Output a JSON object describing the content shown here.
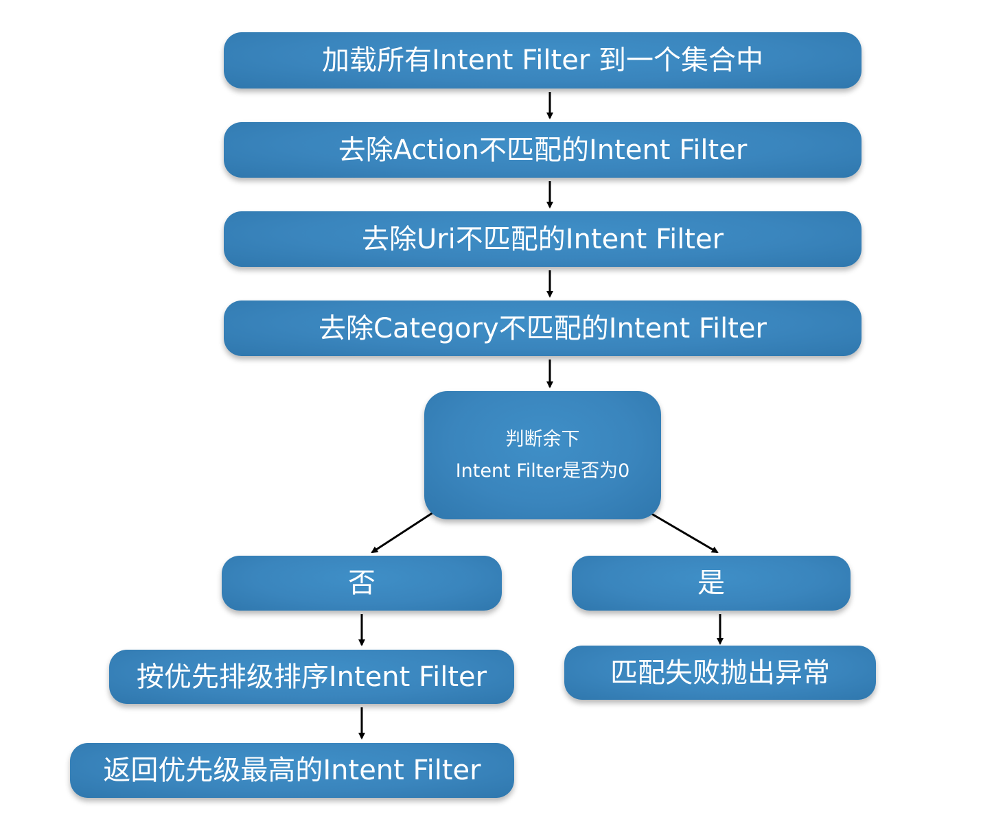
{
  "diagram": {
    "nodes": {
      "load_all": "加载所有Intent Filter 到一个集合中",
      "remove_action": "去除Action不匹配的Intent Filter",
      "remove_uri": "去除Uri不匹配的Intent Filter",
      "remove_category": "去除Category不匹配的Intent Filter",
      "decision_line1": "判断余下",
      "decision_line2": "Intent Filter是否为0",
      "branch_no": "否",
      "branch_yes": "是",
      "sort_priority": "按优先排级排序Intent Filter",
      "match_fail": "匹配失败抛出异常",
      "return_highest": "返回优先级最高的Intent Filter"
    },
    "edges": [
      {
        "from": "load_all",
        "to": "remove_action"
      },
      {
        "from": "remove_action",
        "to": "remove_uri"
      },
      {
        "from": "remove_uri",
        "to": "remove_category"
      },
      {
        "from": "remove_category",
        "to": "decision"
      },
      {
        "from": "decision",
        "to": "branch_no"
      },
      {
        "from": "decision",
        "to": "branch_yes"
      },
      {
        "from": "branch_no",
        "to": "sort_priority"
      },
      {
        "from": "sort_priority",
        "to": "return_highest"
      },
      {
        "from": "branch_yes",
        "to": "match_fail"
      }
    ],
    "colors": {
      "node_fill": "#3a85bd",
      "node_text": "#ffffff",
      "arrow": "#000000"
    }
  }
}
